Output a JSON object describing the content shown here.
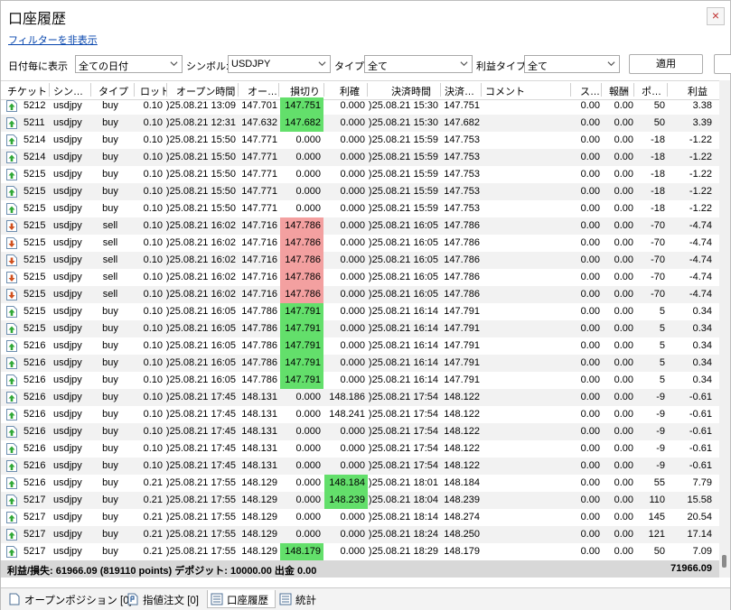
{
  "window": {
    "title": "口座履歴",
    "close_glyph": "×"
  },
  "filter_link": "フィルターを非表示",
  "toolbar": {
    "date_label": "日付毎に表示",
    "date_value": "全ての日付",
    "symbol_label": "シンボル:",
    "symbol_value": "USDJPY",
    "type_label": "タイプ:",
    "type_value": "全て",
    "profit_type_label": "利益タイプ",
    "profit_type_value": "全て",
    "apply_label": "適用"
  },
  "columns": [
    "チケット",
    "シン…",
    "タイプ",
    "ロット",
    "オープン時間",
    "オー…",
    "損切り",
    "利確",
    "決済時間",
    "決済…",
    "コメント",
    "ス…",
    "報酬",
    "ポ…",
    "利益"
  ],
  "colors": {
    "sl_green": "#63df6b",
    "sl_red": "#f3a0a0",
    "buy_icon": "#2fa836",
    "sell_icon": "#d0511f",
    "link": "#0645ad"
  },
  "rows": [
    {
      "type_icon": "buy-arrow-icon",
      "ticket": "5212",
      "symbol": "usdjpy",
      "type": "buy",
      "lot": "0.10",
      "open_time": ")25.08.21 13:09",
      "open_price": "147.701",
      "sl": "147.751",
      "sl_hl": "green",
      "tp": "0.000",
      "tp_hl": "",
      "close_time": ")25.08.21 15:30",
      "close_price": "147.751",
      "comment": "",
      "swap": "0.00",
      "commission": "0.00",
      "points": "50",
      "profit": "3.38"
    },
    {
      "type_icon": "buy-arrow-icon",
      "ticket": "5211",
      "symbol": "usdjpy",
      "type": "buy",
      "lot": "0.10",
      "open_time": ")25.08.21 12:31",
      "open_price": "147.632",
      "sl": "147.682",
      "sl_hl": "green",
      "tp": "0.000",
      "tp_hl": "",
      "close_time": ")25.08.21 15:30",
      "close_price": "147.682",
      "comment": "",
      "swap": "0.00",
      "commission": "0.00",
      "points": "50",
      "profit": "3.39"
    },
    {
      "type_icon": "buy-arrow-icon",
      "ticket": "5214",
      "symbol": "usdjpy",
      "type": "buy",
      "lot": "0.10",
      "open_time": ")25.08.21 15:50",
      "open_price": "147.771",
      "sl": "0.000",
      "sl_hl": "",
      "tp": "0.000",
      "tp_hl": "",
      "close_time": ")25.08.21 15:59",
      "close_price": "147.753",
      "comment": "",
      "swap": "0.00",
      "commission": "0.00",
      "points": "-18",
      "profit": "-1.22"
    },
    {
      "type_icon": "buy-arrow-icon",
      "ticket": "5214",
      "symbol": "usdjpy",
      "type": "buy",
      "lot": "0.10",
      "open_time": ")25.08.21 15:50",
      "open_price": "147.771",
      "sl": "0.000",
      "sl_hl": "",
      "tp": "0.000",
      "tp_hl": "",
      "close_time": ")25.08.21 15:59",
      "close_price": "147.753",
      "comment": "",
      "swap": "0.00",
      "commission": "0.00",
      "points": "-18",
      "profit": "-1.22"
    },
    {
      "type_icon": "buy-arrow-icon",
      "ticket": "5215",
      "symbol": "usdjpy",
      "type": "buy",
      "lot": "0.10",
      "open_time": ")25.08.21 15:50",
      "open_price": "147.771",
      "sl": "0.000",
      "sl_hl": "",
      "tp": "0.000",
      "tp_hl": "",
      "close_time": ")25.08.21 15:59",
      "close_price": "147.753",
      "comment": "",
      "swap": "0.00",
      "commission": "0.00",
      "points": "-18",
      "profit": "-1.22"
    },
    {
      "type_icon": "buy-arrow-icon",
      "ticket": "5215",
      "symbol": "usdjpy",
      "type": "buy",
      "lot": "0.10",
      "open_time": ")25.08.21 15:50",
      "open_price": "147.771",
      "sl": "0.000",
      "sl_hl": "",
      "tp": "0.000",
      "tp_hl": "",
      "close_time": ")25.08.21 15:59",
      "close_price": "147.753",
      "comment": "",
      "swap": "0.00",
      "commission": "0.00",
      "points": "-18",
      "profit": "-1.22"
    },
    {
      "type_icon": "buy-arrow-icon",
      "ticket": "5215",
      "symbol": "usdjpy",
      "type": "buy",
      "lot": "0.10",
      "open_time": ")25.08.21 15:50",
      "open_price": "147.771",
      "sl": "0.000",
      "sl_hl": "",
      "tp": "0.000",
      "tp_hl": "",
      "close_time": ")25.08.21 15:59",
      "close_price": "147.753",
      "comment": "",
      "swap": "0.00",
      "commission": "0.00",
      "points": "-18",
      "profit": "-1.22"
    },
    {
      "type_icon": "sell-arrow-icon",
      "ticket": "5215",
      "symbol": "usdjpy",
      "type": "sell",
      "lot": "0.10",
      "open_time": ")25.08.21 16:02",
      "open_price": "147.716",
      "sl": "147.786",
      "sl_hl": "red",
      "tp": "0.000",
      "tp_hl": "",
      "close_time": ")25.08.21 16:05",
      "close_price": "147.786",
      "comment": "",
      "swap": "0.00",
      "commission": "0.00",
      "points": "-70",
      "profit": "-4.74"
    },
    {
      "type_icon": "sell-arrow-icon",
      "ticket": "5215",
      "symbol": "usdjpy",
      "type": "sell",
      "lot": "0.10",
      "open_time": ")25.08.21 16:02",
      "open_price": "147.716",
      "sl": "147.786",
      "sl_hl": "red",
      "tp": "0.000",
      "tp_hl": "",
      "close_time": ")25.08.21 16:05",
      "close_price": "147.786",
      "comment": "",
      "swap": "0.00",
      "commission": "0.00",
      "points": "-70",
      "profit": "-4.74"
    },
    {
      "type_icon": "sell-arrow-icon",
      "ticket": "5215",
      "symbol": "usdjpy",
      "type": "sell",
      "lot": "0.10",
      "open_time": ")25.08.21 16:02",
      "open_price": "147.716",
      "sl": "147.786",
      "sl_hl": "red",
      "tp": "0.000",
      "tp_hl": "",
      "close_time": ")25.08.21 16:05",
      "close_price": "147.786",
      "comment": "",
      "swap": "0.00",
      "commission": "0.00",
      "points": "-70",
      "profit": "-4.74"
    },
    {
      "type_icon": "sell-arrow-icon",
      "ticket": "5215",
      "symbol": "usdjpy",
      "type": "sell",
      "lot": "0.10",
      "open_time": ")25.08.21 16:02",
      "open_price": "147.716",
      "sl": "147.786",
      "sl_hl": "red",
      "tp": "0.000",
      "tp_hl": "",
      "close_time": ")25.08.21 16:05",
      "close_price": "147.786",
      "comment": "",
      "swap": "0.00",
      "commission": "0.00",
      "points": "-70",
      "profit": "-4.74"
    },
    {
      "type_icon": "sell-arrow-icon",
      "ticket": "5215",
      "symbol": "usdjpy",
      "type": "sell",
      "lot": "0.10",
      "open_time": ")25.08.21 16:02",
      "open_price": "147.716",
      "sl": "147.786",
      "sl_hl": "red",
      "tp": "0.000",
      "tp_hl": "",
      "close_time": ")25.08.21 16:05",
      "close_price": "147.786",
      "comment": "",
      "swap": "0.00",
      "commission": "0.00",
      "points": "-70",
      "profit": "-4.74"
    },
    {
      "type_icon": "buy-arrow-icon",
      "ticket": "5215",
      "symbol": "usdjpy",
      "type": "buy",
      "lot": "0.10",
      "open_time": ")25.08.21 16:05",
      "open_price": "147.786",
      "sl": "147.791",
      "sl_hl": "green",
      "tp": "0.000",
      "tp_hl": "",
      "close_time": ")25.08.21 16:14",
      "close_price": "147.791",
      "comment": "",
      "swap": "0.00",
      "commission": "0.00",
      "points": "5",
      "profit": "0.34"
    },
    {
      "type_icon": "buy-arrow-icon",
      "ticket": "5215",
      "symbol": "usdjpy",
      "type": "buy",
      "lot": "0.10",
      "open_time": ")25.08.21 16:05",
      "open_price": "147.786",
      "sl": "147.791",
      "sl_hl": "green",
      "tp": "0.000",
      "tp_hl": "",
      "close_time": ")25.08.21 16:14",
      "close_price": "147.791",
      "comment": "",
      "swap": "0.00",
      "commission": "0.00",
      "points": "5",
      "profit": "0.34"
    },
    {
      "type_icon": "buy-arrow-icon",
      "ticket": "5216",
      "symbol": "usdjpy",
      "type": "buy",
      "lot": "0.10",
      "open_time": ")25.08.21 16:05",
      "open_price": "147.786",
      "sl": "147.791",
      "sl_hl": "green",
      "tp": "0.000",
      "tp_hl": "",
      "close_time": ")25.08.21 16:14",
      "close_price": "147.791",
      "comment": "",
      "swap": "0.00",
      "commission": "0.00",
      "points": "5",
      "profit": "0.34"
    },
    {
      "type_icon": "buy-arrow-icon",
      "ticket": "5216",
      "symbol": "usdjpy",
      "type": "buy",
      "lot": "0.10",
      "open_time": ")25.08.21 16:05",
      "open_price": "147.786",
      "sl": "147.791",
      "sl_hl": "green",
      "tp": "0.000",
      "tp_hl": "",
      "close_time": ")25.08.21 16:14",
      "close_price": "147.791",
      "comment": "",
      "swap": "0.00",
      "commission": "0.00",
      "points": "5",
      "profit": "0.34"
    },
    {
      "type_icon": "buy-arrow-icon",
      "ticket": "5216",
      "symbol": "usdjpy",
      "type": "buy",
      "lot": "0.10",
      "open_time": ")25.08.21 16:05",
      "open_price": "147.786",
      "sl": "147.791",
      "sl_hl": "green",
      "tp": "0.000",
      "tp_hl": "",
      "close_time": ")25.08.21 16:14",
      "close_price": "147.791",
      "comment": "",
      "swap": "0.00",
      "commission": "0.00",
      "points": "5",
      "profit": "0.34"
    },
    {
      "type_icon": "buy-arrow-icon",
      "ticket": "5216",
      "symbol": "usdjpy",
      "type": "buy",
      "lot": "0.10",
      "open_time": ")25.08.21 17:45",
      "open_price": "148.131",
      "sl": "0.000",
      "sl_hl": "",
      "tp": "148.186",
      "tp_hl": "",
      "close_time": ")25.08.21 17:54",
      "close_price": "148.122",
      "comment": "",
      "swap": "0.00",
      "commission": "0.00",
      "points": "-9",
      "profit": "-0.61"
    },
    {
      "type_icon": "buy-arrow-icon",
      "ticket": "5216",
      "symbol": "usdjpy",
      "type": "buy",
      "lot": "0.10",
      "open_time": ")25.08.21 17:45",
      "open_price": "148.131",
      "sl": "0.000",
      "sl_hl": "",
      "tp": "148.241",
      "tp_hl": "",
      "close_time": ")25.08.21 17:54",
      "close_price": "148.122",
      "comment": "",
      "swap": "0.00",
      "commission": "0.00",
      "points": "-9",
      "profit": "-0.61"
    },
    {
      "type_icon": "buy-arrow-icon",
      "ticket": "5216",
      "symbol": "usdjpy",
      "type": "buy",
      "lot": "0.10",
      "open_time": ")25.08.21 17:45",
      "open_price": "148.131",
      "sl": "0.000",
      "sl_hl": "",
      "tp": "0.000",
      "tp_hl": "",
      "close_time": ")25.08.21 17:54",
      "close_price": "148.122",
      "comment": "",
      "swap": "0.00",
      "commission": "0.00",
      "points": "-9",
      "profit": "-0.61"
    },
    {
      "type_icon": "buy-arrow-icon",
      "ticket": "5216",
      "symbol": "usdjpy",
      "type": "buy",
      "lot": "0.10",
      "open_time": ")25.08.21 17:45",
      "open_price": "148.131",
      "sl": "0.000",
      "sl_hl": "",
      "tp": "0.000",
      "tp_hl": "",
      "close_time": ")25.08.21 17:54",
      "close_price": "148.122",
      "comment": "",
      "swap": "0.00",
      "commission": "0.00",
      "points": "-9",
      "profit": "-0.61"
    },
    {
      "type_icon": "buy-arrow-icon",
      "ticket": "5216",
      "symbol": "usdjpy",
      "type": "buy",
      "lot": "0.10",
      "open_time": ")25.08.21 17:45",
      "open_price": "148.131",
      "sl": "0.000",
      "sl_hl": "",
      "tp": "0.000",
      "tp_hl": "",
      "close_time": ")25.08.21 17:54",
      "close_price": "148.122",
      "comment": "",
      "swap": "0.00",
      "commission": "0.00",
      "points": "-9",
      "profit": "-0.61"
    },
    {
      "type_icon": "buy-arrow-icon",
      "ticket": "5216",
      "symbol": "usdjpy",
      "type": "buy",
      "lot": "0.21",
      "open_time": ")25.08.21 17:55",
      "open_price": "148.129",
      "sl": "0.000",
      "sl_hl": "",
      "tp": "148.184",
      "tp_hl": "green",
      "close_time": ")25.08.21 18:01",
      "close_price": "148.184",
      "comment": "",
      "swap": "0.00",
      "commission": "0.00",
      "points": "55",
      "profit": "7.79"
    },
    {
      "type_icon": "buy-arrow-icon",
      "ticket": "5217",
      "symbol": "usdjpy",
      "type": "buy",
      "lot": "0.21",
      "open_time": ")25.08.21 17:55",
      "open_price": "148.129",
      "sl": "0.000",
      "sl_hl": "",
      "tp": "148.239",
      "tp_hl": "green",
      "close_time": ")25.08.21 18:04",
      "close_price": "148.239",
      "comment": "",
      "swap": "0.00",
      "commission": "0.00",
      "points": "110",
      "profit": "15.58"
    },
    {
      "type_icon": "buy-arrow-icon",
      "ticket": "5217",
      "symbol": "usdjpy",
      "type": "buy",
      "lot": "0.21",
      "open_time": ")25.08.21 17:55",
      "open_price": "148.129",
      "sl": "0.000",
      "sl_hl": "",
      "tp": "0.000",
      "tp_hl": "",
      "close_time": ")25.08.21 18:14",
      "close_price": "148.274",
      "comment": "",
      "swap": "0.00",
      "commission": "0.00",
      "points": "145",
      "profit": "20.54"
    },
    {
      "type_icon": "buy-arrow-icon",
      "ticket": "5217",
      "symbol": "usdjpy",
      "type": "buy",
      "lot": "0.21",
      "open_time": ")25.08.21 17:55",
      "open_price": "148.129",
      "sl": "0.000",
      "sl_hl": "",
      "tp": "0.000",
      "tp_hl": "",
      "close_time": ")25.08.21 18:24",
      "close_price": "148.250",
      "comment": "",
      "swap": "0.00",
      "commission": "0.00",
      "points": "121",
      "profit": "17.14"
    },
    {
      "type_icon": "buy-arrow-icon",
      "ticket": "5217",
      "symbol": "usdjpy",
      "type": "buy",
      "lot": "0.21",
      "open_time": ")25.08.21 17:55",
      "open_price": "148.129",
      "sl": "148.179",
      "sl_hl": "green",
      "tp": "0.000",
      "tp_hl": "",
      "close_time": ")25.08.21 18:29",
      "close_price": "148.179",
      "comment": "",
      "swap": "0.00",
      "commission": "0.00",
      "points": "50",
      "profit": "7.09"
    }
  ],
  "summary": {
    "text": "利益/損失: 61966.09 (819110 points) デポジット: 10000.00 出金 0.00",
    "total": "71966.09"
  },
  "tabs": [
    {
      "label": "オープンポジション [0]",
      "icon": "document-icon"
    },
    {
      "label": "指値注文 [0]",
      "icon": "pending-order-icon"
    },
    {
      "label": "口座履歴",
      "icon": "history-grid-icon",
      "active": true
    },
    {
      "label": "統計",
      "icon": "statistics-grid-icon"
    }
  ]
}
